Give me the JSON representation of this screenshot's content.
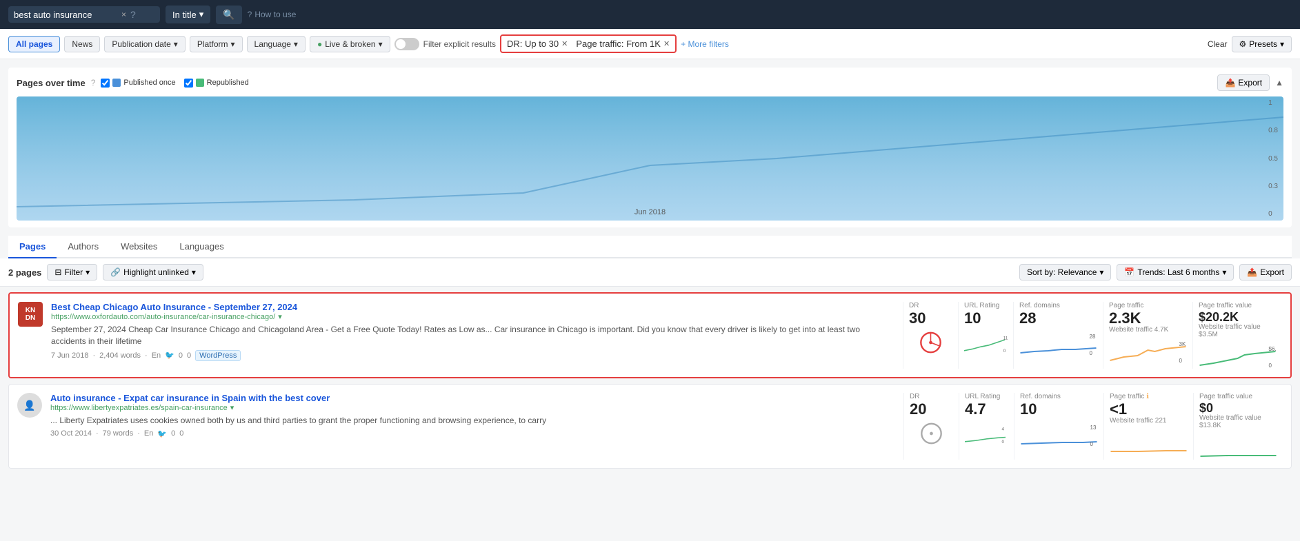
{
  "topBar": {
    "searchValue": "best auto insurance",
    "clearLabel": "×",
    "helpLabel": "?",
    "inTitleLabel": "In title",
    "searchIcon": "🔍",
    "howToUseLabel": "How to use",
    "helpIcon": "?"
  },
  "filterBar": {
    "allPagesLabel": "All pages",
    "newsLabel": "News",
    "pubDateLabel": "Publication date",
    "platformLabel": "Platform",
    "languageLabel": "Language",
    "liveBrokenLabel": "Live & broken",
    "filterExplicitLabel": "Filter explicit results",
    "chip1Label": "DR: Up to 30",
    "chip2Label": "Page traffic: From 1K",
    "moreFiltersLabel": "+ More filters",
    "clearLabel": "Clear",
    "presetsLabel": "Presets"
  },
  "chartSection": {
    "title": "Pages over time",
    "publishedLabel": "Published once",
    "republishedLabel": "Republished",
    "exportLabel": "Export",
    "xAxisLabel": "Jun 2018",
    "yAxisValues": [
      "1",
      "0.8",
      "0.5",
      "0.3",
      "0"
    ]
  },
  "tabs": {
    "items": [
      "Pages",
      "Authors",
      "Websites",
      "Languages"
    ],
    "activeIndex": 0
  },
  "tableActions": {
    "pagesCount": "2 pages",
    "filterLabel": "Filter",
    "highlightUnlinkedLabel": "Highlight unlinked",
    "sortByLabel": "Sort by: Relevance",
    "trendsLabel": "Trends: Last 6 months",
    "exportLabel": "Export"
  },
  "results": [
    {
      "id": "result-1",
      "highlighted": true,
      "faviconText": "KN",
      "faviconBg": "#c0392b",
      "title": "Best Cheap Chicago Auto Insurance - September 27, 2024",
      "url": "https://www.oxfordauto.com/auto-insurance/car-insurance-chicago/",
      "snippet": "September 27, 2024 Cheap Car Insurance Chicago and Chicagoland Area - Get a Free Quote Today! Rates as Low as... Car insurance in Chicago is important. Did you know that every driver is likely to get into at least two accidents in their lifetime",
      "date": "7 Jun 2018",
      "words": "2,404 words",
      "lang": "En",
      "twitter": "0",
      "ref": "0",
      "platform": "WordPress",
      "dr": "30",
      "urlRating": "10",
      "refDomains": "28",
      "pageTraffic": "2.3K",
      "websiteTraffic": "Website traffic 4.7K",
      "pageTrafficValue": "$20.2K",
      "websiteTrafficValue": "Website traffic value $3.5M"
    },
    {
      "id": "result-2",
      "highlighted": false,
      "faviconText": "👤",
      "faviconBg": "#ddd",
      "title": "Auto insurance - Expat car insurance in Spain with the best cover",
      "url": "https://www.libertyexpatriates.es/spain-car-insurance",
      "snippet": "... Liberty Expatriates uses cookies owned both by us and third parties to grant the proper functioning and browsing experience, to carry",
      "date": "30 Oct 2014",
      "words": "79 words",
      "lang": "En",
      "twitter": "0",
      "ref": "0",
      "platform": "",
      "dr": "20",
      "urlRating": "4.7",
      "refDomains": "10",
      "pageTraffic": "<1",
      "websiteTraffic": "Website traffic 221",
      "pageTrafficValue": "$0",
      "websiteTrafficValue": "Website traffic value $13.8K"
    }
  ]
}
